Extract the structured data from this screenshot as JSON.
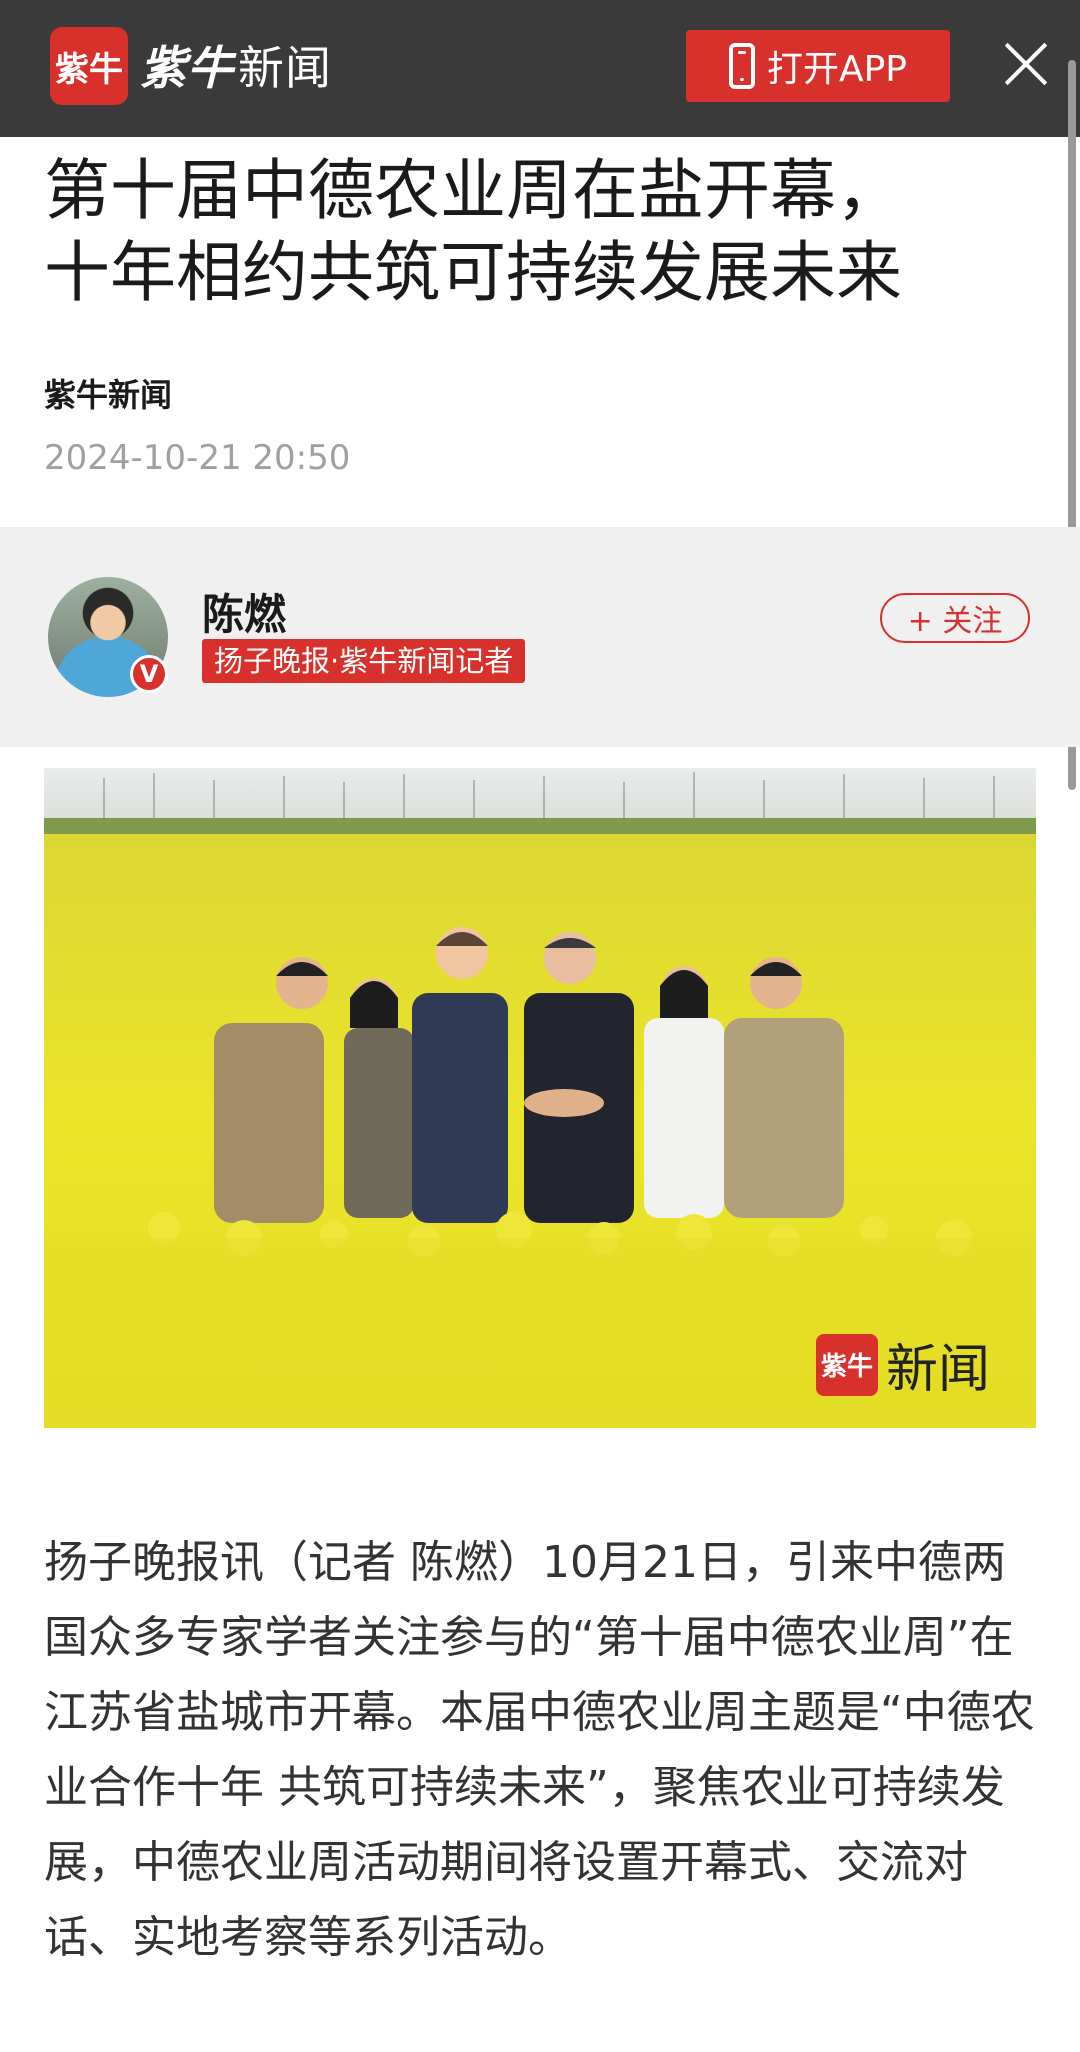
{
  "header": {
    "logo_badge": "紫牛",
    "logo_brand": "紫牛",
    "logo_name": "新闻",
    "open_app_label": "打开APP"
  },
  "article": {
    "title": "第十届中德农业周在盐开幕，\n十年相约共筑可持续发展未来",
    "source": "紫牛新闻",
    "date": "2024-10-21 20:50"
  },
  "author": {
    "name": "陈燃",
    "title": "扬子晚报·紫牛新闻记者",
    "follow_label": "+ 关注",
    "verified_mark": "V"
  },
  "photo": {
    "watermark_badge": "紫牛",
    "watermark_text": "新闻"
  },
  "body": {
    "paragraph": "扬子晚报讯（记者 陈燃）10月21日，引来中德两国众多专家学者关注参与的“第十届中德农业周”在江苏省盐城市开幕。本届中德农业周主题是“中德农业合作十年 共筑可持续未来”，聚焦农业可持续发展，中德农业周活动期间将设置开幕式、交流对话、实地考察等系列活动。"
  },
  "colors": {
    "brand_red": "#d8312b",
    "header_bg": "#3a3a3a"
  }
}
